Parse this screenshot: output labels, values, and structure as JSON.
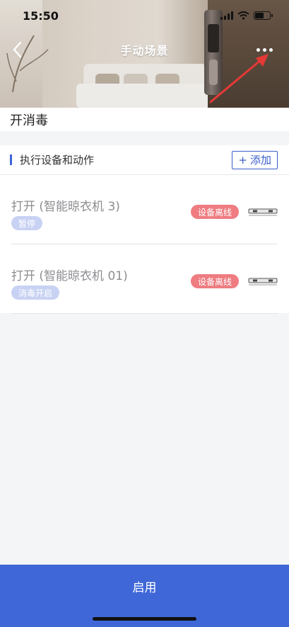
{
  "status_bar": {
    "time": "15:50"
  },
  "nav": {
    "title": "手动场景"
  },
  "scene": {
    "name": "开消毒"
  },
  "section": {
    "title": "执行设备和动作",
    "add_label": "添加",
    "add_icon": "+"
  },
  "devices": [
    {
      "action": "打开 (智能晾衣机 3)",
      "tag": "暂停",
      "status": "设备离线"
    },
    {
      "action": "打开 (智能晾衣机 01)",
      "tag": "消毒开启",
      "status": "设备离线"
    }
  ],
  "footer": {
    "enable_label": "启用"
  },
  "colors": {
    "primary": "#3f67d8",
    "offline": "#ee7c81",
    "tag_bg": "#c8d2f3",
    "annotation_arrow": "#e53935"
  }
}
